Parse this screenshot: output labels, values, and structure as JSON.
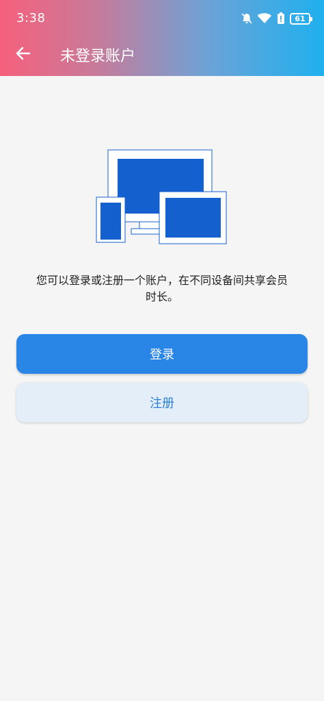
{
  "status_bar": {
    "time": "3:38",
    "battery_level": "61",
    "icons": [
      "mute-bell-icon",
      "wifi-icon",
      "battery-saver-icon",
      "battery-icon"
    ]
  },
  "app_bar": {
    "title": "未登录账户",
    "back_icon": "arrow-left-icon"
  },
  "illustration": {
    "name": "multi-device-icon",
    "accent_color": "#1460cf"
  },
  "main": {
    "message": "您可以登录或注册一个账户，在不同设备间共享会员时长。",
    "login_label": "登录",
    "register_label": "注册"
  },
  "colors": {
    "primary": "#2a86e6",
    "secondary_bg": "#e4eef9",
    "secondary_text": "#2a7fd8"
  }
}
